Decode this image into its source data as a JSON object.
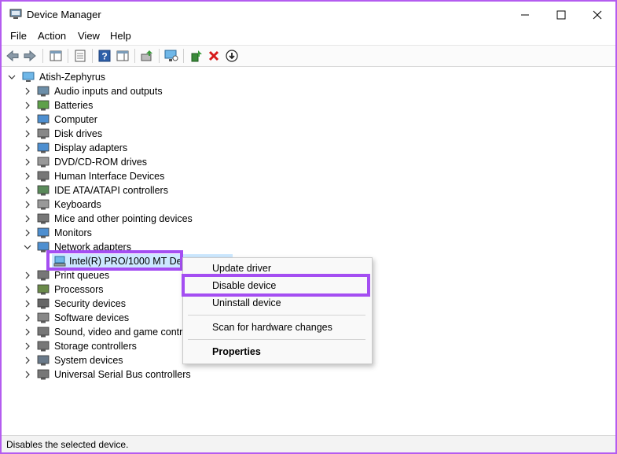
{
  "window": {
    "title": "Device Manager"
  },
  "menu": [
    "File",
    "Action",
    "View",
    "Help"
  ],
  "tree": {
    "root": "Atish-Zephyrus",
    "categories": [
      "Audio inputs and outputs",
      "Batteries",
      "Computer",
      "Disk drives",
      "Display adapters",
      "DVD/CD-ROM drives",
      "Human Interface Devices",
      "IDE ATA/ATAPI controllers",
      "Keyboards",
      "Mice and other pointing devices",
      "Monitors",
      "Network adapters",
      "Print queues",
      "Processors",
      "Security devices",
      "Software devices",
      "Sound, video and game controllers",
      "Storage controllers",
      "System devices",
      "Universal Serial Bus controllers"
    ],
    "selected_device": "Intel(R) PRO/1000 MT Desktop Adapter"
  },
  "context_menu": {
    "update_driver": "Update driver",
    "disable_device": "Disable device",
    "uninstall_device": "Uninstall device",
    "scan_hardware": "Scan for hardware changes",
    "properties": "Properties"
  },
  "status_bar": {
    "text": "Disables the selected device."
  },
  "colors": {
    "highlight": "#a44ef2",
    "window_border": "#b45cf0",
    "selection": "#cce8ff"
  }
}
